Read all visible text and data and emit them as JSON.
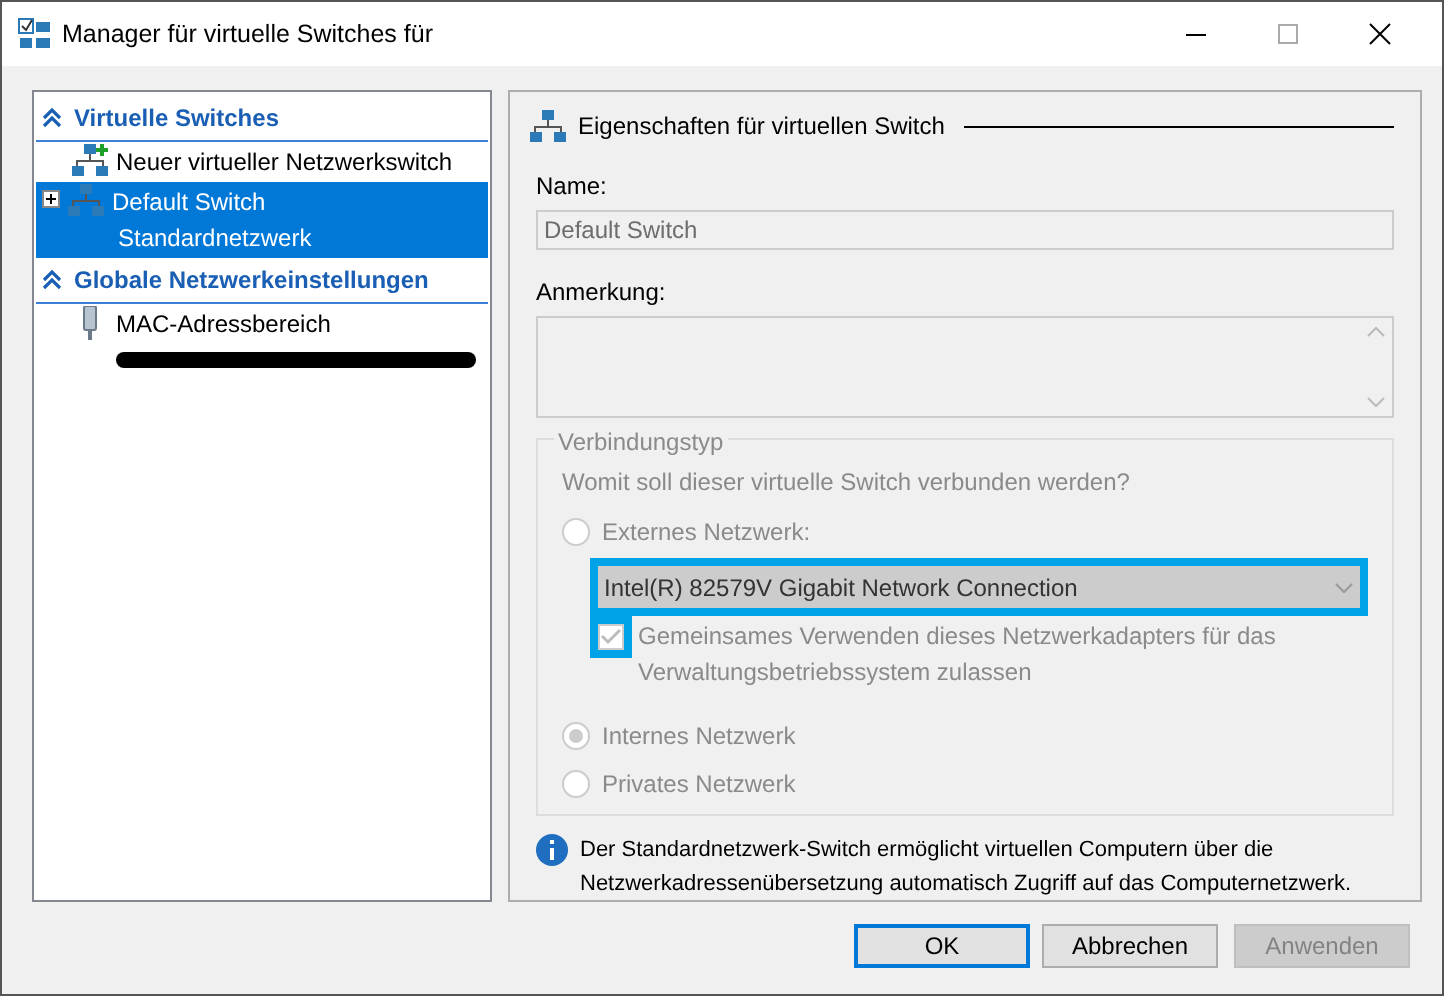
{
  "window": {
    "title": "Manager für virtuelle Switches für"
  },
  "sidebar": {
    "items": [
      {
        "kind": "header",
        "label": "Virtuelle Switches",
        "expanded": true
      },
      {
        "kind": "action",
        "label": "Neuer virtueller Netzwerkswitch",
        "selected": false
      },
      {
        "kind": "switch",
        "label": "Default Switch",
        "sublabel": "Standardnetzwerk",
        "selected": true,
        "expanded": false
      },
      {
        "kind": "header",
        "label": "Globale Netzwerkeinstellungen",
        "expanded": true
      },
      {
        "kind": "setting",
        "label": "MAC-Adressbereich",
        "selected": false,
        "redacted": true
      }
    ]
  },
  "properties": {
    "title": "Eigenschaften für virtuellen Switch",
    "name_label": "Name:",
    "name_value": "Default Switch",
    "name_disabled": true,
    "note_label": "Anmerkung:",
    "connection": {
      "legend": "Verbindungstyp",
      "question": "Womit soll dieser virtuelle Switch verbunden werden?",
      "options": [
        {
          "label": "Externes Netzwerk:",
          "selected": false,
          "disabled": true,
          "adapter": {
            "value": "Intel(R) 82579V Gigabit Network Connection",
            "highlighted": true
          },
          "share": {
            "label": "Gemeinsames Verwenden dieses Netzwerkadapters für das Verwaltungsbetriebssystem zulassen",
            "checked": true,
            "highlighted": true
          }
        },
        {
          "label": "Internes Netzwerk",
          "selected": true,
          "disabled": true
        },
        {
          "label": "Privates Netzwerk",
          "selected": false,
          "disabled": true
        }
      ]
    },
    "info": "Der Standardnetzwerk-Switch ermöglicht virtuellen Computern über die Netzwerkadressenübersetzung automatisch Zugriff auf das Computernetzwerk."
  },
  "buttons": [
    {
      "label": "OK",
      "default": true,
      "disabled": false
    },
    {
      "label": "Abbrechen",
      "default": false,
      "disabled": false
    },
    {
      "label": "Anwenden",
      "default": false,
      "disabled": true
    }
  ]
}
